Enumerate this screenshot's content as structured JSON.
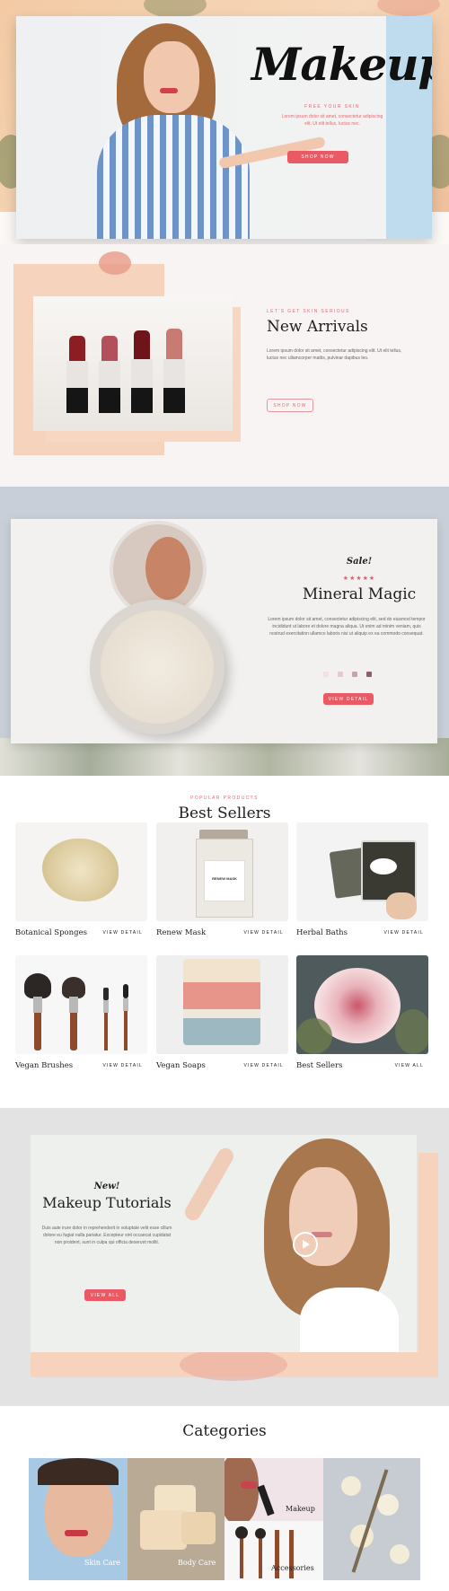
{
  "hero": {
    "title": "Makeup",
    "tagline": "FREE YOUR SKIN",
    "body": "Lorem ipsum dolor sit amet, consectetur adipiscing elit. Ut elit tellus, luctus nec.",
    "cta": "SHOP NOW"
  },
  "arrivals": {
    "eyebrow": "LET'S GET SKIN SERIOUS",
    "title": "New Arrivals",
    "body": "Lorem ipsum dolor sit amet, consectetur adipiscing elit. Ut elit tellus, luctus nec ullamcorper mattis, pulvinar dapibus leo.",
    "cta": "SHOP NOW"
  },
  "mineral": {
    "badge": "Sale!",
    "rating": 5,
    "stars": "★★★★★",
    "title": "Mineral Magic",
    "body": "Lorem ipsum dolor sit amet, consectetur adipiscing elit, sed do eiusmod tempor incididunt ut labore et dolore magna aliqua. Ut enim ad minim veniam, quis nostrud exercitation ullamco laboris nisi ut aliquip ex ea commodo consequat.",
    "swatches": [
      "#f4dede",
      "#e9c9cd",
      "#c9a3a8",
      "#8f6068"
    ],
    "cta": "VIEW DETAIL"
  },
  "bestsellers": {
    "eyebrow": "POPULAR PRODUCTS",
    "title": "Best Sellers",
    "items": [
      {
        "name": "Botanical Sponges",
        "link": "VIEW DETAIL"
      },
      {
        "name": "Renew Mask",
        "link": "VIEW DETAIL"
      },
      {
        "name": "Herbal Baths",
        "link": "VIEW DETAIL"
      },
      {
        "name": "Vegan Brushes",
        "link": "VIEW DETAIL"
      },
      {
        "name": "Vegan Soaps",
        "link": "VIEW DETAIL"
      },
      {
        "name": "Best Sellers",
        "link": "VIEW ALL"
      }
    ],
    "jar_label": "RENEW MASK"
  },
  "tutorials": {
    "badge": "New!",
    "title": "Makeup Tutorials",
    "body": "Duis aute irure dolor in reprehenderit in voluptate velit esse cillum dolore eu fugiat nulla pariatur. Excepteur sint occaecat cupidatat non proident, sunt in culpa qui officia deserunt mollit.",
    "cta": "VIEW ALL"
  },
  "categories": {
    "title": "Categories",
    "items": [
      {
        "label": "Skin Care"
      },
      {
        "label": "Body Care"
      },
      {
        "label": "Makeup"
      },
      {
        "label": "Accessories"
      }
    ]
  },
  "colors": {
    "accent": "#ea5a64",
    "peach": "#f6d3bd",
    "blue_panel": "#bfdcef",
    "slate_band": "#c8cfd8"
  }
}
